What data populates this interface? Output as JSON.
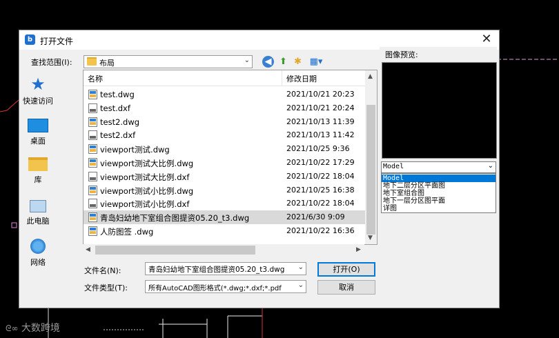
{
  "dialog": {
    "title": "打开文件",
    "close_glyph": "✕",
    "look_in_label": "查找范围(I):",
    "look_in_value": "布局",
    "filename_label": "文件名(N):",
    "filename_value": "青岛妇幼地下室组合图提资05.20_t3.dwg",
    "filetype_label": "文件类型(T):",
    "filetype_value": "所有AutoCAD图形格式(*.dwg;*.dxf;*.pdf",
    "open_button": "打开(O)",
    "cancel_button": "取消",
    "preview_label": "图像预览:"
  },
  "places": [
    {
      "label": "快速访问",
      "icon": "star-icon"
    },
    {
      "label": "桌面",
      "icon": "desktop-icon"
    },
    {
      "label": "库",
      "icon": "library-icon"
    },
    {
      "label": "此电脑",
      "icon": "computer-icon"
    },
    {
      "label": "网络",
      "icon": "network-icon"
    }
  ],
  "columns": {
    "name": "名称",
    "date": "修改日期"
  },
  "files": [
    {
      "name": "test.dwg",
      "date": "2021/10/21 20:23",
      "type": "dwg"
    },
    {
      "name": "test.dxf",
      "date": "2021/10/21 20:24",
      "type": "dxf"
    },
    {
      "name": "test2.dwg",
      "date": "2021/10/13 11:39",
      "type": "dwg"
    },
    {
      "name": "test2.dxf",
      "date": "2021/10/13 11:42",
      "type": "dxf"
    },
    {
      "name": "viewport测试.dwg",
      "date": "2021/10/25 9:36",
      "type": "dwg"
    },
    {
      "name": "viewport测试大比例.dwg",
      "date": "2021/10/22 17:29",
      "type": "dwg"
    },
    {
      "name": "viewport测试大比例.dxf",
      "date": "2021/10/22 18:04",
      "type": "dxf"
    },
    {
      "name": "viewport测试小比例.dwg",
      "date": "2021/10/25 16:38",
      "type": "dwg"
    },
    {
      "name": "viewport测试小比例.dxf",
      "date": "2021/10/22 18:04",
      "type": "dxf"
    },
    {
      "name": "青岛妇幼地下室组合图提资05.20_t3.dwg",
      "date": "2021/6/30 9:09",
      "type": "dwg",
      "selected": true
    },
    {
      "name": "人防图签 .dwg",
      "date": "2021/10/22 16:36",
      "type": "dwg"
    }
  ],
  "layout": {
    "selected": "Model",
    "options": [
      "Model",
      "地下二层分区平面图",
      "地下室组合图",
      "地下一层分区图平面",
      "详图"
    ]
  },
  "watermark": "大数跨境",
  "colors": {
    "accent": "#0078d7",
    "selection": "#d9d9d9"
  }
}
